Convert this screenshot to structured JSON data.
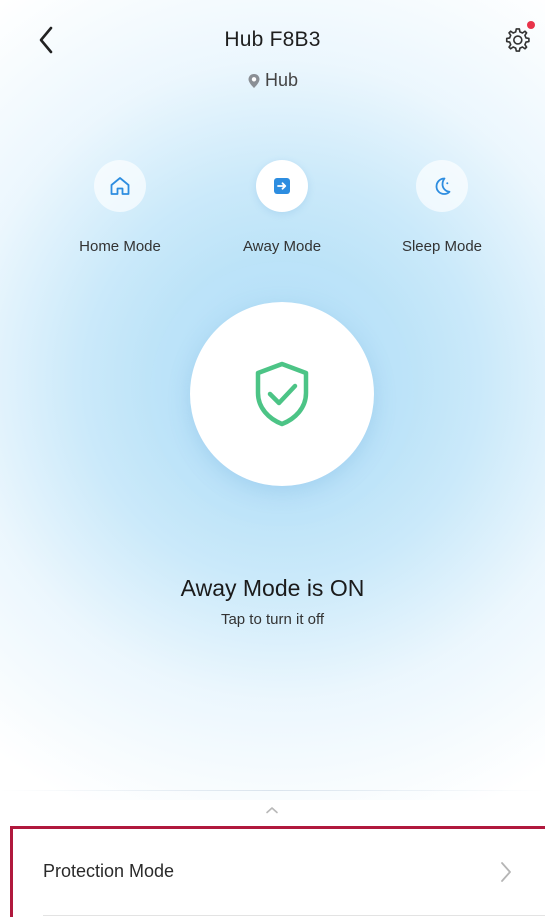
{
  "header": {
    "title": "Hub F8B3",
    "location": "Hub"
  },
  "modes": [
    {
      "label": "Home Mode",
      "icon": "home-icon",
      "active": false
    },
    {
      "label": "Away Mode",
      "icon": "away-icon",
      "active": true
    },
    {
      "label": "Sleep Mode",
      "icon": "moon-icon",
      "active": false
    }
  ],
  "status": {
    "title": "Away Mode is ON",
    "subtitle": "Tap to turn it off"
  },
  "protection": {
    "label": "Protection Mode"
  },
  "colors": {
    "accent": "#2d8de0",
    "shield_green": "#4cc486",
    "notification_dot": "#e8334a",
    "highlight_border": "#b0183d"
  }
}
